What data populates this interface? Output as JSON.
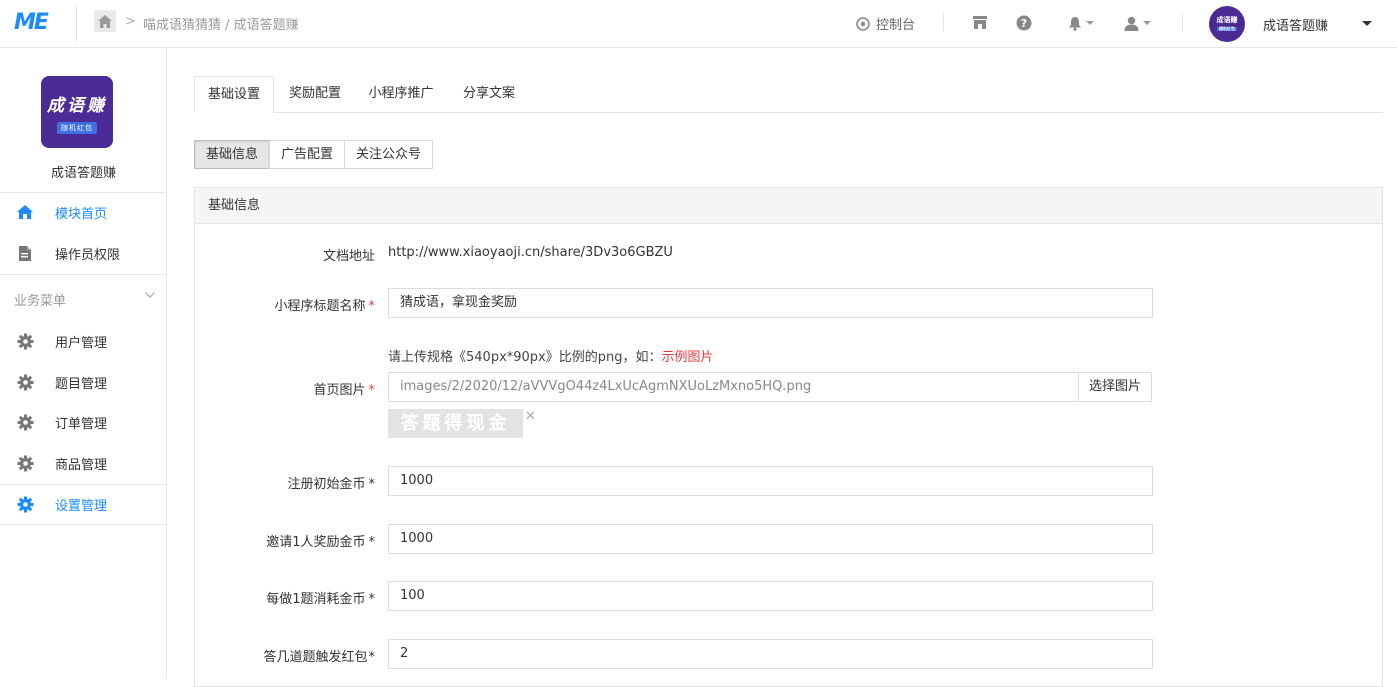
{
  "topbar": {
    "logo_text": "ME",
    "breadcrumb": "喵成语猜猜猜 / 成语答题赚",
    "console_label": "控制台",
    "avatar_text": "成语赚",
    "avatar_tag": "随机红包",
    "user_name": "成语答题赚"
  },
  "sidebar": {
    "app_logo_text": "成语赚",
    "app_logo_tag": "随机红包",
    "app_name": "成语答题赚",
    "top_items": [
      {
        "label": "模块首页",
        "icon": "home-icon",
        "active": true
      },
      {
        "label": "操作员权限",
        "icon": "document-icon",
        "active": false
      }
    ],
    "group_title": "业务菜单",
    "group_items": [
      {
        "label": "用户管理",
        "icon": "gear-icon",
        "active": false
      },
      {
        "label": "题目管理",
        "icon": "gear-icon",
        "active": false
      },
      {
        "label": "订单管理",
        "icon": "gear-icon",
        "active": false
      },
      {
        "label": "商品管理",
        "icon": "gear-icon",
        "active": false
      },
      {
        "label": "设置管理",
        "icon": "gear-icon",
        "active": true
      }
    ]
  },
  "tabs": [
    "基础设置",
    "奖励配置",
    "小程序推广",
    "分享文案"
  ],
  "subtabs": [
    "基础信息",
    "广告配置",
    "关注公众号"
  ],
  "panel": {
    "title": "基础信息",
    "doc_label": "文档地址",
    "doc_url": "http://www.xiaoyaoji.cn/share/3Dv3o6GBZU",
    "title_label": "小程序标题名称",
    "title_value": "猜成语，拿现金奖励",
    "image_hint": "请上传规格《540px*90px》比例的png，如：",
    "image_hint_link": "示例图片",
    "image_label": "首页图片",
    "image_value": "images/2/2020/12/aVVVgO44z4LxUcAgmNXUoLzMxno5HQ.png",
    "image_button": "选择图片",
    "image_preview_text": "答题得现金",
    "initial_coins_label": "注册初始金币",
    "initial_coins_value": "1000",
    "invite_label": "邀请1人奖励金币",
    "invite_value": "1000",
    "cost_label": "每做1题消耗金币",
    "cost_value": "100",
    "redpack_label": "答几道题触发红包",
    "redpack_value": "2",
    "required_mark": "*"
  },
  "colors": {
    "accent": "#1a8cff",
    "brand_purple": "#4b2c96",
    "required": "#e4393c"
  }
}
